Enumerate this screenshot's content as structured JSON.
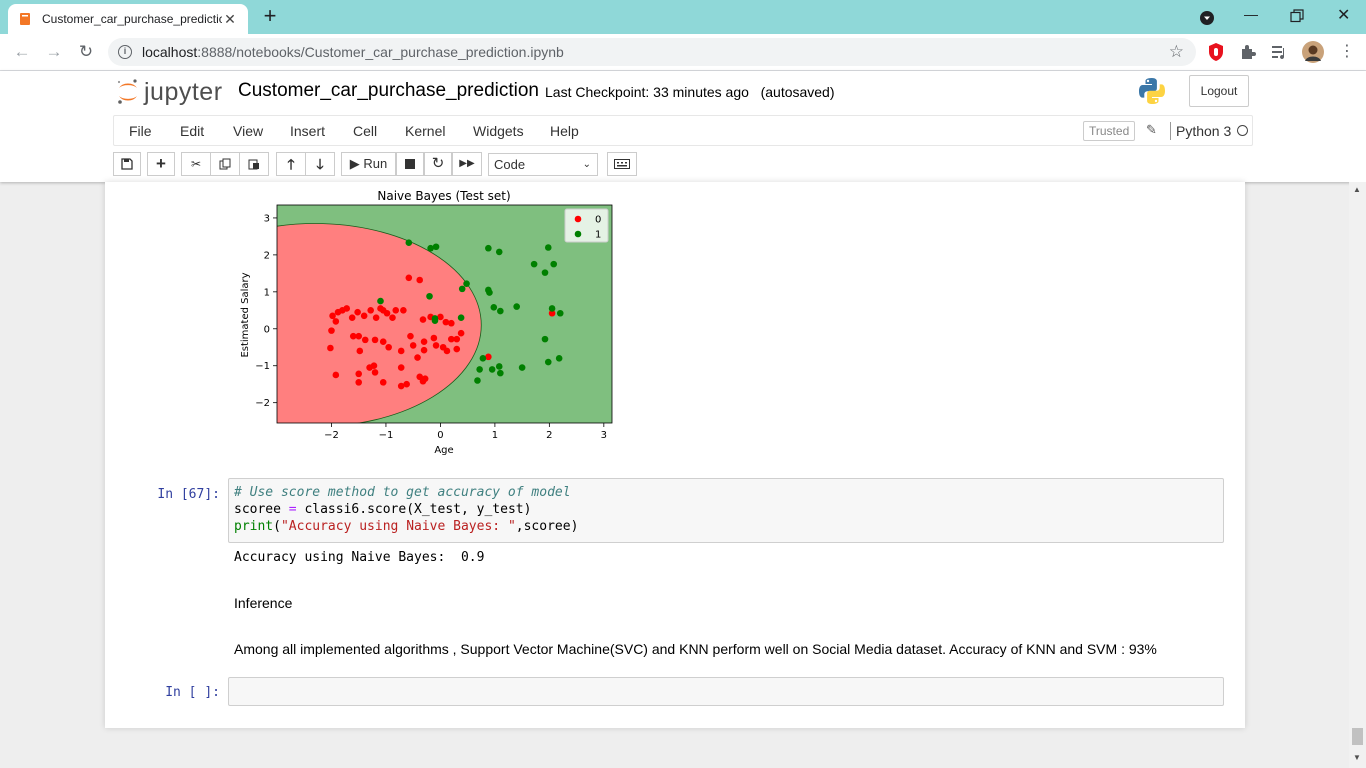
{
  "browser": {
    "tab_title": "Customer_car_purchase_predictic",
    "new_tab": "+",
    "url_host": "localhost",
    "url_rest": ":8888/notebooks/Customer_car_purchase_prediction.ipynb"
  },
  "jupyter": {
    "logo_text": "jupyter",
    "notebook_name": "Customer_car_purchase_prediction",
    "checkpoint": "Last Checkpoint: 33 minutes ago",
    "autosaved": "(autosaved)",
    "logout": "Logout"
  },
  "menubar": {
    "items": [
      "File",
      "Edit",
      "View",
      "Insert",
      "Cell",
      "Kernel",
      "Widgets",
      "Help"
    ],
    "trusted": "Trusted",
    "kernel_name": "Python 3"
  },
  "toolbar": {
    "run_label": "Run",
    "cell_type": "Code"
  },
  "cells": {
    "code_prompt": "In [67]:",
    "code_lines": {
      "comment": "# Use score method to get accuracy of model",
      "line2_var": "scoree ",
      "line2_op": "=",
      "line2_rest": " classi6.score(X_test, y_test)",
      "line3_kw": "print",
      "line3_open": "(",
      "line3_str": "\"Accuracy using Naive Bayes: \"",
      "line3_rest": ",scoree)"
    },
    "output_text": "Accuracy using Naive Bayes:  0.9",
    "md_heading": "Inference",
    "md_text": "Among all implemented algorithms , Support Vector Machine(SVC) and KNN perform well on Social Media dataset. Accuracy of KNN and SVM : 93%",
    "empty_prompt": "In [ ]:"
  },
  "colors": {
    "region_0": "#ff7f7f",
    "region_1": "#7fbf7f",
    "point_0": "#ff0000",
    "point_1": "#008000"
  },
  "chart_data": {
    "type": "scatter",
    "title": "Naive Bayes (Test set)",
    "xlabel": "Age",
    "ylabel": "Estimated Salary",
    "xlim": [
      -3.0,
      3.15
    ],
    "ylim": [
      -2.55,
      3.35
    ],
    "xticks": [
      "−2",
      "−1",
      "0",
      "1",
      "2",
      "3"
    ],
    "xtick_values": [
      -2,
      -1,
      0,
      1,
      2,
      3
    ],
    "yticks": [
      "3",
      "2",
      "1",
      "0",
      "−1",
      "−2"
    ],
    "ytick_values": [
      3,
      2,
      1,
      0,
      -1,
      -2
    ],
    "legend_position": "top-right",
    "decision_boundary": "ellipse",
    "series": [
      {
        "name": "0",
        "color": "#ff0000",
        "points": [
          [
            -1.98,
            0.35
          ],
          [
            -1.92,
            0.2
          ],
          [
            -1.88,
            0.45
          ],
          [
            -1.8,
            0.5
          ],
          [
            -1.72,
            0.55
          ],
          [
            -1.62,
            0.3
          ],
          [
            -1.52,
            0.45
          ],
          [
            -1.4,
            0.35
          ],
          [
            -1.28,
            0.5
          ],
          [
            -1.18,
            0.3
          ],
          [
            -1.1,
            0.55
          ],
          [
            -1.05,
            0.5
          ],
          [
            -0.98,
            0.42
          ],
          [
            -0.88,
            0.3
          ],
          [
            -0.82,
            0.5
          ],
          [
            -0.68,
            0.5
          ],
          [
            -0.32,
            0.25
          ],
          [
            -0.18,
            0.32
          ],
          [
            0.0,
            0.32
          ],
          [
            0.1,
            0.18
          ],
          [
            0.2,
            0.15
          ],
          [
            -2.0,
            -0.05
          ],
          [
            -2.02,
            -0.52
          ],
          [
            -1.6,
            -0.2
          ],
          [
            -1.5,
            -0.2
          ],
          [
            -1.48,
            -0.6
          ],
          [
            -1.38,
            -0.3
          ],
          [
            -1.2,
            -0.3
          ],
          [
            -1.05,
            -0.35
          ],
          [
            -0.95,
            -0.5
          ],
          [
            -0.72,
            -0.6
          ],
          [
            -0.55,
            -0.2
          ],
          [
            -0.5,
            -0.45
          ],
          [
            -0.42,
            -0.78
          ],
          [
            -0.3,
            -0.35
          ],
          [
            -0.3,
            -0.58
          ],
          [
            -0.12,
            -0.25
          ],
          [
            -0.08,
            -0.45
          ],
          [
            0.12,
            -0.6
          ],
          [
            0.2,
            -0.28
          ],
          [
            0.3,
            -0.28
          ],
          [
            0.3,
            -0.55
          ],
          [
            0.38,
            -0.12
          ],
          [
            0.05,
            -0.5
          ],
          [
            -1.92,
            -1.25
          ],
          [
            -1.5,
            -1.22
          ],
          [
            -1.5,
            -1.45
          ],
          [
            -1.3,
            -1.05
          ],
          [
            -1.22,
            -1.0
          ],
          [
            -1.2,
            -1.18
          ],
          [
            -1.05,
            -1.45
          ],
          [
            -0.72,
            -1.05
          ],
          [
            -0.72,
            -1.55
          ],
          [
            -0.62,
            -1.5
          ],
          [
            -0.38,
            -1.3
          ],
          [
            -0.32,
            -1.42
          ],
          [
            -0.28,
            -1.35
          ],
          [
            -0.58,
            1.38
          ],
          [
            -0.38,
            1.32
          ],
          [
            0.88,
            -0.76
          ],
          [
            2.05,
            0.42
          ]
        ]
      },
      {
        "name": "1",
        "color": "#008000",
        "points": [
          [
            -0.58,
            2.33
          ],
          [
            -0.18,
            2.18
          ],
          [
            -0.08,
            2.22
          ],
          [
            0.88,
            2.18
          ],
          [
            1.08,
            2.08
          ],
          [
            1.98,
            2.2
          ],
          [
            1.72,
            1.75
          ],
          [
            1.92,
            1.52
          ],
          [
            2.08,
            1.75
          ],
          [
            0.48,
            1.22
          ],
          [
            0.88,
            1.05
          ],
          [
            0.4,
            1.08
          ],
          [
            -0.2,
            0.88
          ],
          [
            0.9,
            0.98
          ],
          [
            -1.1,
            0.75
          ],
          [
            0.98,
            0.58
          ],
          [
            1.1,
            0.48
          ],
          [
            1.4,
            0.6
          ],
          [
            2.05,
            0.55
          ],
          [
            2.2,
            0.42
          ],
          [
            -0.1,
            0.28
          ],
          [
            0.38,
            0.3
          ],
          [
            -0.1,
            0.22
          ],
          [
            0.78,
            -0.8
          ],
          [
            0.72,
            -1.1
          ],
          [
            0.68,
            -1.4
          ],
          [
            0.95,
            -1.1
          ],
          [
            1.08,
            -1.02
          ],
          [
            1.1,
            -1.2
          ],
          [
            1.5,
            -1.05
          ],
          [
            1.92,
            -0.28
          ],
          [
            1.98,
            -0.9
          ],
          [
            2.18,
            -0.8
          ]
        ]
      }
    ]
  }
}
